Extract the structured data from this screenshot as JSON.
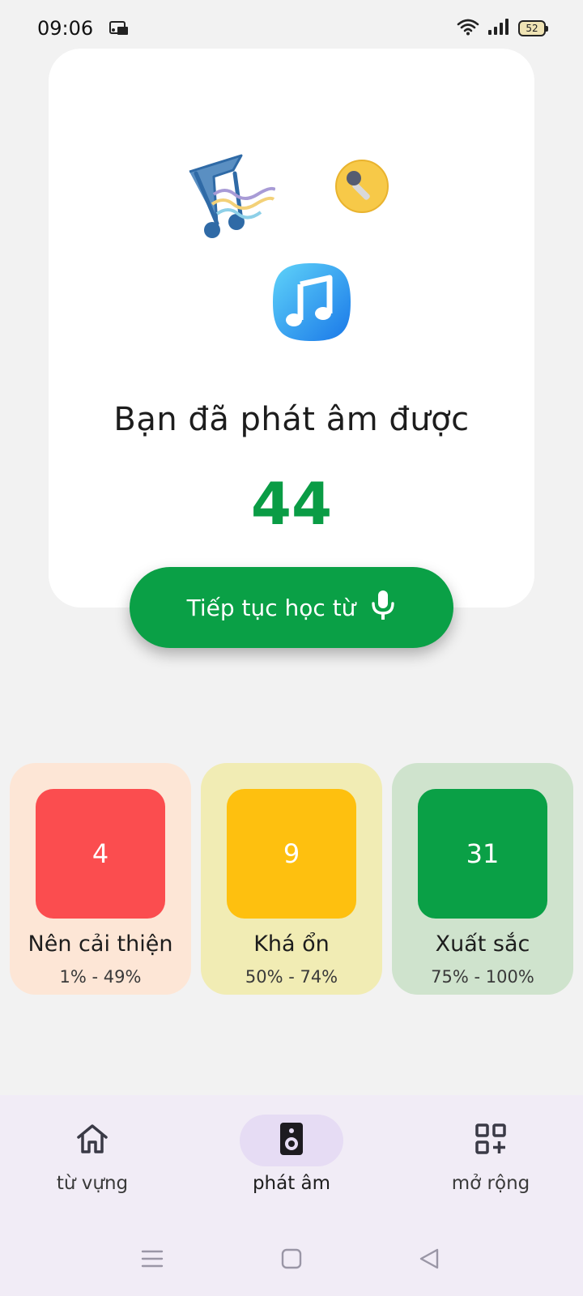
{
  "status_bar": {
    "time": "09:06",
    "notification_icon": "cast-icon",
    "wifi_icon": "wifi-icon",
    "signal_icon": "signal-icon",
    "battery": "52"
  },
  "hero": {
    "title": "Bạn đã phát âm được",
    "count": "44",
    "decorations": [
      "music-notes-wave-icon",
      "microphone-badge-icon",
      "music-app-icon"
    ]
  },
  "continue_button": {
    "label": "Tiếp tục học từ",
    "icon": "microphone-icon"
  },
  "stats": [
    {
      "count": "4",
      "label": "Nên cải thiện",
      "range": "1% - 49%",
      "color": "#fb4d4f",
      "bg": "#fde6d6"
    },
    {
      "count": "9",
      "label": "Khá ổn",
      "range": "50% - 74%",
      "color": "#fec00f",
      "bg": "#f1ecb4"
    },
    {
      "count": "31",
      "label": "Xuất sắc",
      "range": "75% - 100%",
      "color": "#0aa046",
      "bg": "#cfe3cd"
    }
  ],
  "bottom_nav": {
    "items": [
      {
        "label": "từ vựng",
        "icon": "home-icon",
        "active": false
      },
      {
        "label": "phát âm",
        "icon": "speaker-icon",
        "active": true
      },
      {
        "label": "mở rộng",
        "icon": "apps-add-icon",
        "active": false
      }
    ]
  },
  "system_nav": [
    "menu-icon",
    "home-square-icon",
    "back-triangle-icon"
  ],
  "colors": {
    "accent_green": "#0aa046",
    "count_green": "#0a9c45",
    "nav_background": "#f1ecf6",
    "nav_active_pill": "#e6dcf4"
  }
}
